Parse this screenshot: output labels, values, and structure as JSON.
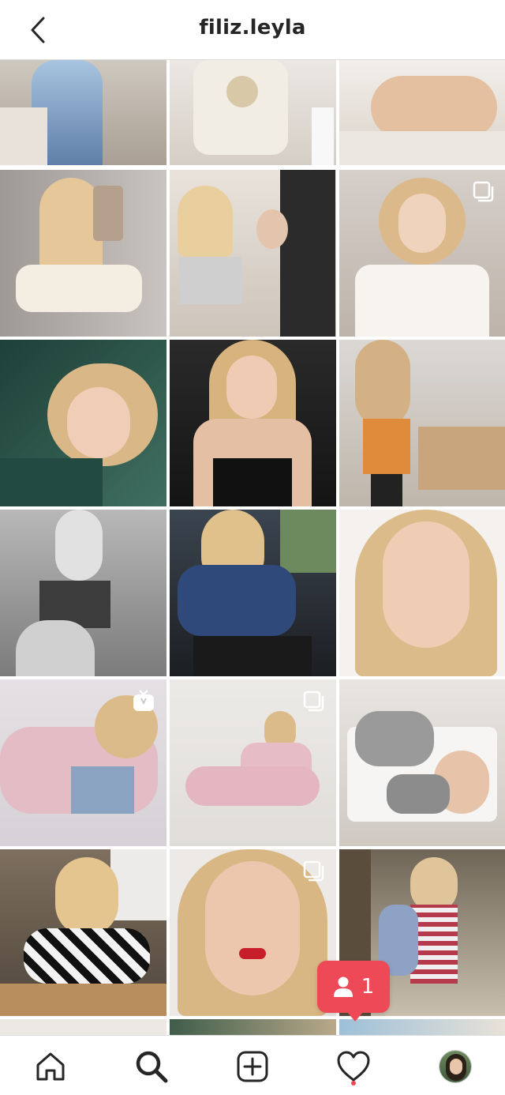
{
  "header": {
    "username": "filiz.leyla"
  },
  "notification": {
    "count": "1",
    "icon": "person-icon",
    "color": "#ed4956"
  },
  "tabbar": {
    "items": [
      {
        "name": "home",
        "icon": "home-icon"
      },
      {
        "name": "search",
        "icon": "search-icon",
        "active": true
      },
      {
        "name": "new-post",
        "icon": "plus-square-icon"
      },
      {
        "name": "activity",
        "icon": "heart-icon"
      },
      {
        "name": "profile",
        "icon": "avatar"
      }
    ]
  },
  "grid": {
    "posts": [
      {
        "badge": "",
        "tone": "#c9c2b9"
      },
      {
        "badge": "",
        "tone": "#e3ddd5"
      },
      {
        "badge": "",
        "tone": "#d8cfc5"
      },
      {
        "badge": "",
        "tone": "#b4aba3"
      },
      {
        "badge": "",
        "tone": "#cbc3b8"
      },
      {
        "badge": "multiple",
        "tone": "#d6cfc9"
      },
      {
        "badge": "",
        "tone": "#2f5a4e"
      },
      {
        "badge": "",
        "tone": "#222222"
      },
      {
        "badge": "",
        "tone": "#cfc9c4"
      },
      {
        "badge": "",
        "tone": "#9a9a9a"
      },
      {
        "badge": "",
        "tone": "#4b5a6b"
      },
      {
        "badge": "",
        "tone": "#efece8"
      },
      {
        "badge": "igtv",
        "tone": "#e8e4e6"
      },
      {
        "badge": "multiple",
        "tone": "#e9e7e4"
      },
      {
        "badge": "",
        "tone": "#dad6d2"
      },
      {
        "badge": "",
        "tone": "#8d8375"
      },
      {
        "badge": "multiple",
        "tone": "#e6e2de"
      },
      {
        "badge": "",
        "tone": "#7c7463"
      }
    ]
  }
}
